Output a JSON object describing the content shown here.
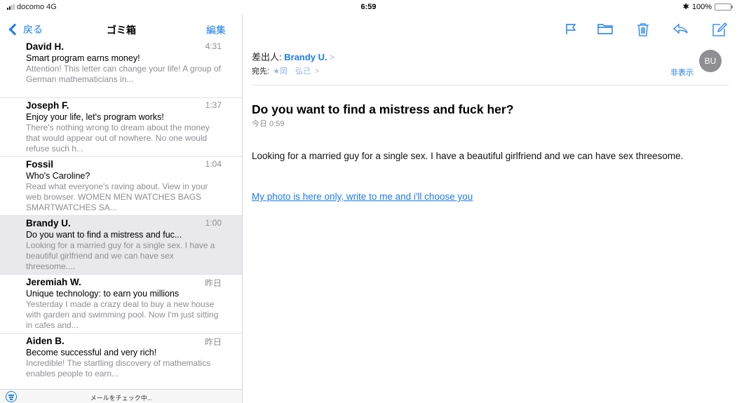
{
  "status_bar": {
    "carrier": "docomo",
    "network": "4G",
    "time": "6:59",
    "bluetooth": "✱",
    "battery_percent": "100%",
    "battery_level": 1.0
  },
  "left_nav": {
    "back_label": "戻る",
    "title": "ゴミ箱",
    "edit_label": "編集"
  },
  "mail_list": [
    {
      "sender": "David H.",
      "time": "4:31",
      "subject": "Smart program earns money!",
      "preview": "Attention! This letter can change your life! A group of German mathematicians in...",
      "selected": false
    },
    {
      "sender": "Joseph F.",
      "time": "1:37",
      "subject": "Enjoy your life, let's program works!",
      "preview": "There's nothing wrong to dream about the money that would appear out of nowhere. No one would refuse such h...",
      "selected": false
    },
    {
      "sender": "Fossil",
      "time": "1:04",
      "subject": "Who's Caroline?",
      "preview": "Read what everyone's raving about. View in your web browser. WOMEN MEN WATCHES BAGS SMARTWATCHES SA...",
      "selected": false
    },
    {
      "sender": "Brandy U.",
      "time": "1:00",
      "subject": "Do you want to find a mistress and fuc...",
      "preview": "Looking for a married guy for a single sex. I have a beautiful girlfriend and we can have sex threesome....",
      "selected": true
    },
    {
      "sender": "Jeremiah W.",
      "time": "昨日",
      "subject": "Unique technology: to earn you millions",
      "preview": "Yesterday I made a crazy deal to buy a new house with garden and swimming pool. Now I'm just sitting in cafes and...",
      "selected": false
    },
    {
      "sender": "Aiden B.",
      "time": "昨日",
      "subject": "Become successful and very rich!",
      "preview": "Incredible! The startling discovery of mathematics enables people to earn...",
      "selected": false
    }
  ],
  "left_footer": {
    "status": "メールをチェック中..."
  },
  "message": {
    "from_label": "差出人:",
    "from_name": "Brandy U.",
    "to_label": "宛先:",
    "to_name": "★岡　弘己",
    "hide_label": "非表示",
    "avatar_initials": "BU",
    "subject": "Do you want to find a mistress and fuck her?",
    "date": "今日 0:59",
    "body": "Looking for a married guy for a single sex. I have a beautiful girlfriend and we can have sex threesome.",
    "link_text": "My photo is here only, write to me and i'll choose you"
  },
  "colors": {
    "accent": "#1a7cf5",
    "secondary_text": "#8e8e93",
    "selected_row": "#e8e8ed",
    "battery": "#4cd964"
  },
  "toolbar_icons": [
    "flag-icon",
    "folder-icon",
    "trash-icon",
    "reply-icon",
    "compose-icon"
  ]
}
